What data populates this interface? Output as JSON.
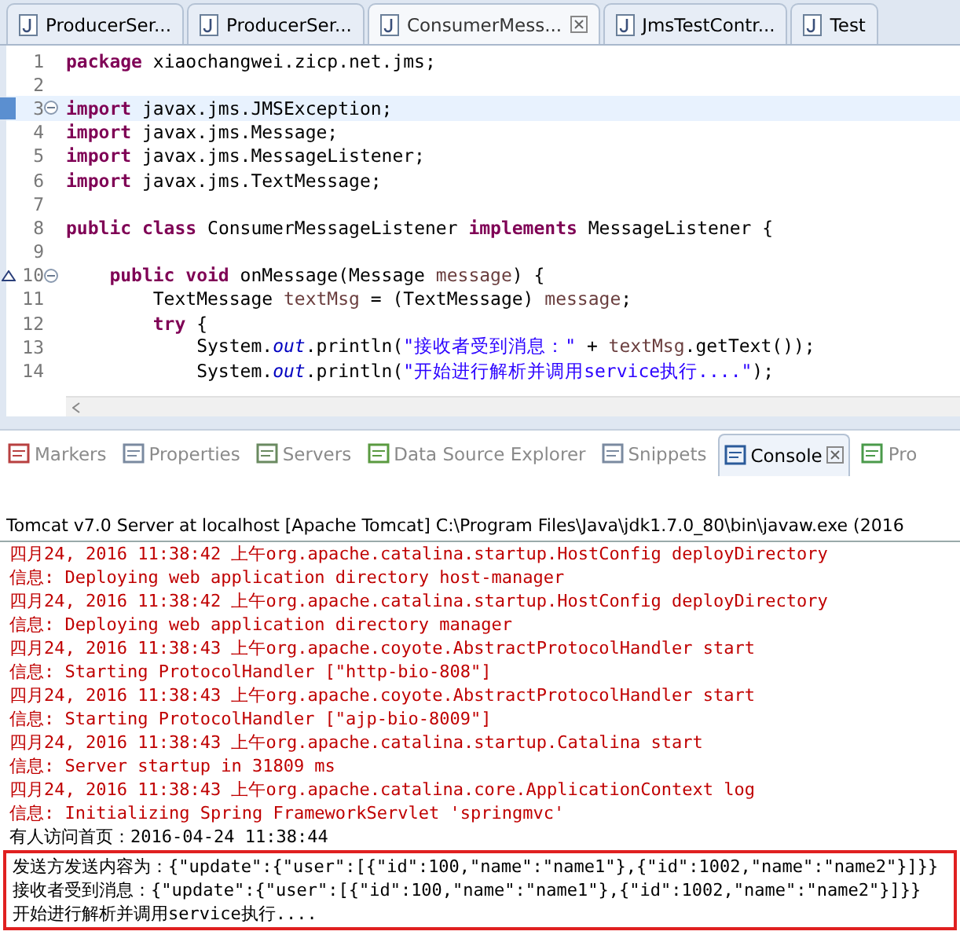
{
  "editor_tabs": [
    {
      "label": "ProducerSer...",
      "selected": false
    },
    {
      "label": "ProducerSer...",
      "selected": false
    },
    {
      "label": "ConsumerMess...",
      "selected": true
    },
    {
      "label": "JmsTestContr...",
      "selected": false
    },
    {
      "label": "Test",
      "selected": false
    }
  ],
  "code_lines": [
    {
      "number": "1",
      "current": false,
      "fold": false,
      "override": false,
      "tokens": [
        {
          "kind": "keyword",
          "text": "package"
        },
        {
          "kind": "plain",
          "text": " xiaochangwei.zicp.net.jms;"
        }
      ]
    },
    {
      "number": "2",
      "current": false,
      "fold": false,
      "override": false
    },
    {
      "number": "3",
      "current": true,
      "fold": true,
      "override": false,
      "tokens": [
        {
          "kind": "keyword",
          "text": "import"
        },
        {
          "kind": "plain",
          "text": " javax.jms.JMSException;"
        }
      ]
    },
    {
      "number": "4",
      "current": false,
      "fold": false,
      "override": false,
      "tokens": [
        {
          "kind": "keyword",
          "text": "import"
        },
        {
          "kind": "plain",
          "text": " javax.jms.Message;"
        }
      ]
    },
    {
      "number": "5",
      "current": false,
      "fold": false,
      "override": false,
      "tokens": [
        {
          "kind": "keyword",
          "text": "import"
        },
        {
          "kind": "plain",
          "text": " javax.jms.MessageListener;"
        }
      ]
    },
    {
      "number": "6",
      "current": false,
      "fold": false,
      "override": false,
      "tokens": [
        {
          "kind": "keyword",
          "text": "import"
        },
        {
          "kind": "plain",
          "text": " javax.jms.TextMessage;"
        }
      ]
    },
    {
      "number": "7",
      "current": false,
      "fold": false,
      "override": false
    },
    {
      "number": "8",
      "current": false,
      "fold": false,
      "override": false,
      "tokens": [
        {
          "kind": "keyword",
          "text": "public class"
        },
        {
          "kind": "plain",
          "text": " ConsumerMessageListener "
        },
        {
          "kind": "keyword",
          "text": "implements"
        },
        {
          "kind": "plain",
          "text": " MessageListener {"
        }
      ]
    },
    {
      "number": "9",
      "current": false,
      "fold": false,
      "override": false
    },
    {
      "number": "10",
      "current": false,
      "fold": true,
      "override": true,
      "tokens": [
        {
          "kind": "keyword",
          "text": "    public void"
        },
        {
          "kind": "plain",
          "text": " onMessage(Message "
        },
        {
          "kind": "variable",
          "text": "message"
        },
        {
          "kind": "plain",
          "text": ") {"
        }
      ]
    },
    {
      "number": "11",
      "current": false,
      "fold": false,
      "override": false,
      "tokens": [
        {
          "kind": "plain",
          "text": "        TextMessage "
        },
        {
          "kind": "variable",
          "text": "textMsg"
        },
        {
          "kind": "plain",
          "text": " = (TextMessage) "
        },
        {
          "kind": "variable",
          "text": "message"
        },
        {
          "kind": "plain",
          "text": ";"
        }
      ]
    },
    {
      "number": "12",
      "current": false,
      "fold": false,
      "override": false,
      "tokens": [
        {
          "kind": "keyword",
          "text": "        try"
        },
        {
          "kind": "plain",
          "text": " {"
        }
      ]
    },
    {
      "number": "13",
      "current": false,
      "fold": false,
      "override": false,
      "tokens": [
        {
          "kind": "plain",
          "text": "            System."
        },
        {
          "kind": "field",
          "text": "out"
        },
        {
          "kind": "plain",
          "text": ".println("
        },
        {
          "kind": "string",
          "text": "\"接收者受到消息：\""
        },
        {
          "kind": "plain",
          "text": " + "
        },
        {
          "kind": "variable",
          "text": "textMsg"
        },
        {
          "kind": "plain",
          "text": ".getText());"
        }
      ]
    },
    {
      "number": "14",
      "current": false,
      "fold": false,
      "override": false,
      "tokens": [
        {
          "kind": "plain",
          "text": "            System."
        },
        {
          "kind": "field",
          "text": "out"
        },
        {
          "kind": "plain",
          "text": ".println("
        },
        {
          "kind": "string",
          "text": "\"开始进行解析并调用service执行....\""
        },
        {
          "kind": "plain",
          "text": ");"
        }
      ]
    }
  ],
  "view_tabs": [
    {
      "label": "Markers",
      "selected": false
    },
    {
      "label": "Properties",
      "selected": false
    },
    {
      "label": "Servers",
      "selected": false
    },
    {
      "label": "Data Source Explorer",
      "selected": false
    },
    {
      "label": "Snippets",
      "selected": false
    },
    {
      "label": "Console",
      "selected": true
    },
    {
      "label": "Pro",
      "selected": false
    }
  ],
  "console": {
    "title": "Tomcat v7.0 Server at localhost [Apache Tomcat] C:\\Program Files\\Java\\jdk1.7.0_80\\bin\\javaw.exe (2016",
    "lines": [
      {
        "color": "#c00000",
        "text": "四月24, 2016 11:38:42 上午org.apache.catalina.startup.HostConfig deployDirectory"
      },
      {
        "color": "#c00000",
        "text": "信息: Deploying web application directory host-manager"
      },
      {
        "color": "#c00000",
        "text": "四月24, 2016 11:38:42 上午org.apache.catalina.startup.HostConfig deployDirectory"
      },
      {
        "color": "#c00000",
        "text": "信息: Deploying web application directory manager"
      },
      {
        "color": "#c00000",
        "text": "四月24, 2016 11:38:43 上午org.apache.coyote.AbstractProtocolHandler start"
      },
      {
        "color": "#c00000",
        "text": "信息: Starting ProtocolHandler [\"http-bio-808\"]"
      },
      {
        "color": "#c00000",
        "text": "四月24, 2016 11:38:43 上午org.apache.coyote.AbstractProtocolHandler start"
      },
      {
        "color": "#c00000",
        "text": "信息: Starting ProtocolHandler [\"ajp-bio-8009\"]"
      },
      {
        "color": "#c00000",
        "text": "四月24, 2016 11:38:43 上午org.apache.catalina.startup.Catalina start"
      },
      {
        "color": "#c00000",
        "text": "信息: Server startup in 31809 ms"
      },
      {
        "color": "#c00000",
        "text": "四月24, 2016 11:38:43 上午org.apache.catalina.core.ApplicationContext log"
      },
      {
        "color": "#c00000",
        "text": "信息: Initializing Spring FrameworkServlet 'springmvc'"
      },
      {
        "color": "#000000",
        "text": "有人访问首页：2016-04-24 11:38:44"
      }
    ],
    "marked_lines": [
      {
        "color": "#000000",
        "text": "发送方发送内容为：{\"update\":{\"user\":[{\"id\":100,\"name\":\"name1\"},{\"id\":1002,\"name\":\"name2\"}]}}"
      },
      {
        "color": "#000000",
        "text": "接收者受到消息：{\"update\":{\"user\":[{\"id\":100,\"name\":\"name1\"},{\"id\":1002,\"name\":\"name2\"}]}}"
      },
      {
        "color": "#000000",
        "text": "开始进行解析并调用service执行...."
      }
    ]
  }
}
